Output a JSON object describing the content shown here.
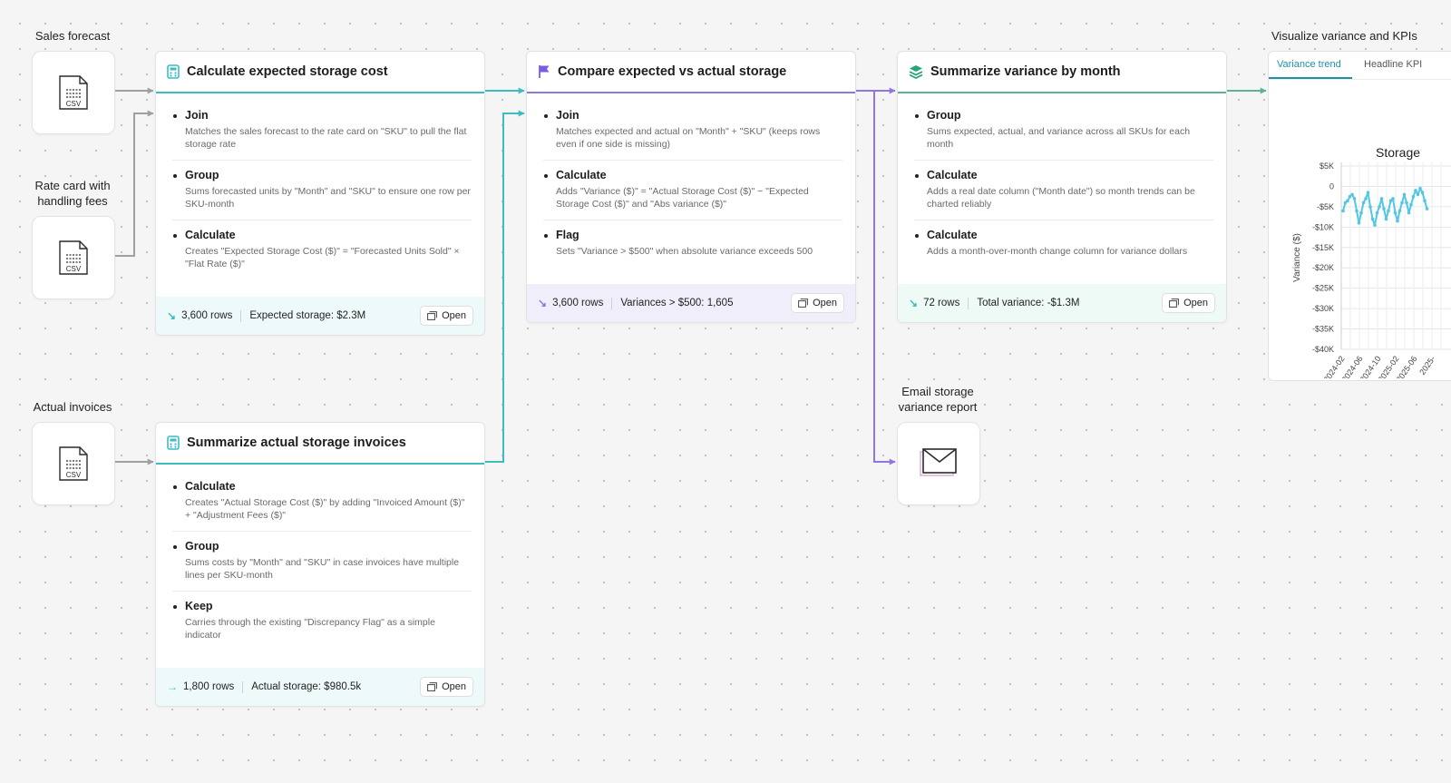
{
  "colors": {
    "teal": "#3dbcc3",
    "purple": "#9276e0",
    "green": "#5bb391",
    "gray": "#a0a0a0",
    "teal_bg": "#eefafa",
    "purple_bg": "#f1eefb",
    "green_bg": "#eefaf6",
    "chart_line": "#53c6e4"
  },
  "sources": {
    "sales_forecast": {
      "label": "Sales forecast",
      "file_type": "CSV",
      "icon": "csv-file-icon"
    },
    "rate_card": {
      "label": "Rate card with handling fees",
      "file_type": "CSV",
      "icon": "csv-file-icon"
    },
    "actual_invoices": {
      "label": "Actual invoices",
      "file_type": "CSV",
      "icon": "csv-file-icon"
    }
  },
  "cards": {
    "expected": {
      "title": "Calculate expected storage cost",
      "icon": "calculator-icon",
      "steps": [
        {
          "title": "Join",
          "desc": "Matches the sales forecast to the rate card on \"SKU\" to pull the flat storage rate"
        },
        {
          "title": "Group",
          "desc": "Sums forecasted units by \"Month\" and \"SKU\" to ensure one row per SKU-month"
        },
        {
          "title": "Calculate",
          "desc": "Creates \"Expected Storage Cost ($)\" = \"Forecasted Units Sold\" × \"Flat Rate ($)\""
        }
      ],
      "footer": {
        "rows": "3,600 rows",
        "metric": "Expected storage: $2.3M",
        "open": "Open"
      }
    },
    "actual": {
      "title": "Summarize actual storage invoices",
      "icon": "calculator-icon",
      "steps": [
        {
          "title": "Calculate",
          "desc": "Creates \"Actual Storage Cost ($)\" by adding \"Invoiced Amount ($)\" + \"Adjustment Fees ($)\""
        },
        {
          "title": "Group",
          "desc": "Sums costs by \"Month\" and \"SKU\" in case invoices have multiple lines per SKU-month"
        },
        {
          "title": "Keep",
          "desc": "Carries through the existing \"Discrepancy Flag\" as a simple indicator"
        }
      ],
      "footer": {
        "rows": "1,800 rows",
        "metric": "Actual storage: $980.5k",
        "open": "Open"
      }
    },
    "compare": {
      "title": "Compare expected vs actual storage",
      "icon": "flag-icon",
      "steps": [
        {
          "title": "Join",
          "desc": "Matches expected and actual on \"Month\" + \"SKU\" (keeps rows even if one side is missing)"
        },
        {
          "title": "Calculate",
          "desc": "Adds \"Variance ($)\" = \"Actual Storage Cost ($)\" − \"Expected Storage Cost ($)\" and \"Abs variance ($)\""
        },
        {
          "title": "Flag",
          "desc": "Sets \"Variance > $500\" when absolute variance exceeds 500"
        }
      ],
      "footer": {
        "rows": "3,600 rows",
        "metric": "Variances > $500: 1,605",
        "open": "Open"
      }
    },
    "summary": {
      "title": "Summarize variance by month",
      "icon": "layers-icon",
      "steps": [
        {
          "title": "Group",
          "desc": "Sums expected, actual, and variance across all SKUs for each month"
        },
        {
          "title": "Calculate",
          "desc": "Adds a real date column (\"Month date\") so month trends can be charted reliably"
        },
        {
          "title": "Calculate",
          "desc": "Adds a month-over-month change column for variance dollars"
        }
      ],
      "footer": {
        "rows": "72 rows",
        "metric": "Total variance: -$1.3M",
        "open": "Open"
      }
    }
  },
  "email": {
    "label": "Email storage variance report",
    "icon": "envelope-icon"
  },
  "viz": {
    "label": "Visualize variance and KPIs",
    "tabs": [
      "Variance trend",
      "Headline KPI"
    ],
    "chart_title": "Storage",
    "chart_data": {
      "type": "line",
      "title": "Storage",
      "xlabel": "",
      "ylabel": "Variance ($)",
      "ylim": [
        -40000,
        5000
      ],
      "yticks": [
        5000,
        0,
        -5000,
        -10000,
        -15000,
        -20000,
        -25000,
        -30000,
        -35000,
        -40000
      ],
      "ytick_labels": [
        "$5K",
        "0",
        "-$5K",
        "-$10K",
        "-$15K",
        "-$20K",
        "-$25K",
        "-$30K",
        "-$35K",
        "-$40K"
      ],
      "xtick_labels": [
        "2024-02",
        "2024-06",
        "2024-10",
        "2025-02",
        "2025-06",
        "2025-"
      ],
      "grid": true,
      "series": [
        {
          "values": [
            -6000,
            -4000,
            -3500,
            -2500,
            -2000,
            -3000,
            -6000,
            -9000,
            -6500,
            -4000,
            -3000,
            -1500,
            -5000,
            -8000,
            -9500,
            -6500,
            -5000,
            -3000,
            -5500,
            -8000,
            -6000,
            -3500,
            -3000,
            -6500,
            -8500,
            -6000,
            -4000,
            -2000,
            -4000,
            -6500,
            -4500,
            -2500,
            -1000,
            -2000,
            -500,
            -1500,
            -3500,
            -5500
          ]
        }
      ]
    }
  }
}
